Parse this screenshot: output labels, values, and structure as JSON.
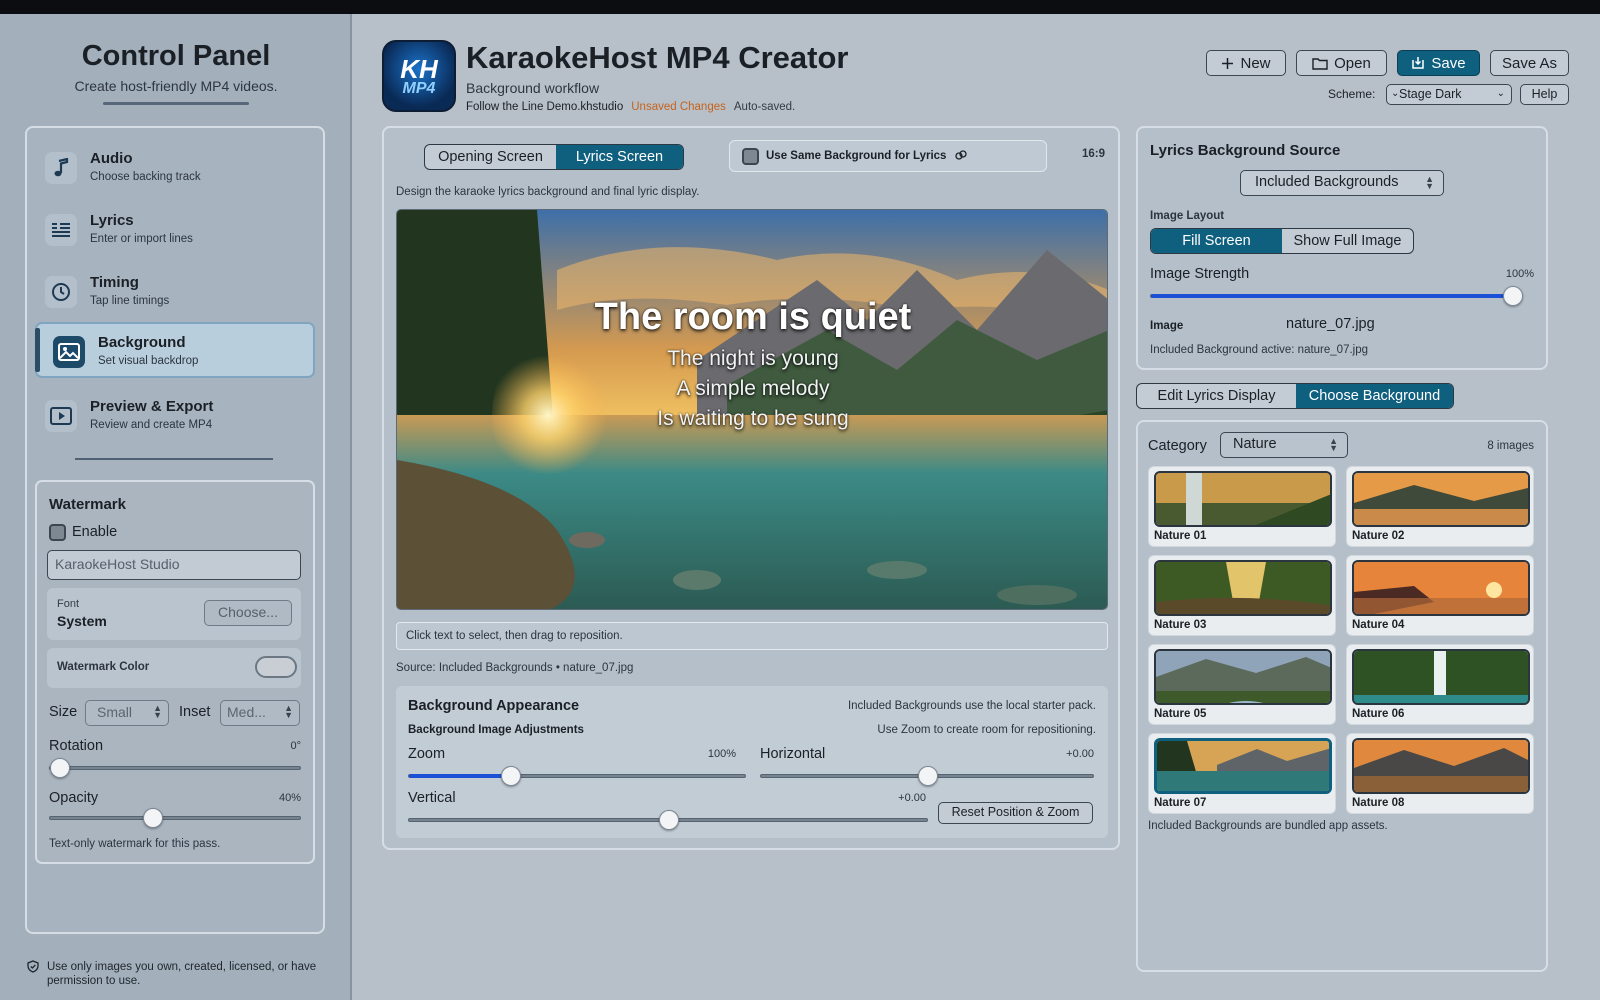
{
  "sidebar": {
    "title": "Control Panel",
    "subtitle": "Create host-friendly MP4 videos.",
    "steps": [
      {
        "title": "Audio",
        "subtitle": "Choose backing track",
        "icon": "music-note-icon"
      },
      {
        "title": "Lyrics",
        "subtitle": "Enter or import lines",
        "icon": "lyrics-list-icon"
      },
      {
        "title": "Timing",
        "subtitle": "Tap line timings",
        "icon": "timer-icon"
      },
      {
        "title": "Background",
        "subtitle": "Set visual backdrop",
        "icon": "image-icon",
        "active": true
      },
      {
        "title": "Preview & Export",
        "subtitle": "Review and create MP4",
        "icon": "play-screen-icon"
      }
    ],
    "watermark": {
      "title": "Watermark",
      "enable_label": "Enable",
      "enabled": false,
      "text_value": "KaraokeHost Studio",
      "font_label": "Font",
      "font_value": "System",
      "choose_label": "Choose...",
      "color_label": "Watermark Color",
      "size_label": "Size",
      "size_value": "Small",
      "inset_label": "Inset",
      "inset_value": "Med...",
      "rotation_label": "Rotation",
      "rotation_value": "0°",
      "rotation_fraction": 0.0,
      "opacity_label": "Opacity",
      "opacity_value": "40%",
      "opacity_fraction": 0.4,
      "note": "Text-only watermark for this pass."
    },
    "disclaimer": "Use only images you own, created, licensed, or have permission to use."
  },
  "header": {
    "logo_text_top": "KH",
    "logo_text_bottom": "MP4",
    "title": "KaraokeHost MP4 Creator",
    "subtitle": "Background workflow",
    "file_name": "Follow the Line Demo.khstudio",
    "unsaved": "Unsaved Changes",
    "autosave": "Auto-saved.",
    "buttons": {
      "new": "New",
      "open": "Open",
      "save": "Save",
      "save_as": "Save As"
    },
    "scheme_label": "Scheme:",
    "scheme_value": "Stage Dark",
    "help": "Help"
  },
  "center": {
    "tabs": [
      "Opening Screen",
      "Lyrics Screen"
    ],
    "active_tab": "Lyrics Screen",
    "same_bg_label": "Use Same Background for Lyrics",
    "aspect": "16:9",
    "description": "Design the karaoke lyrics background and final lyric display.",
    "lyrics": {
      "current": "The room is quiet",
      "next": [
        "The night is young",
        "A simple melody",
        "Is waiting to be sung"
      ]
    },
    "hint": "Click text to select, then drag to reposition.",
    "source": "Source: Included Backgrounds • nature_07.jpg",
    "appearance": {
      "title": "Background Appearance",
      "note1": "Included Backgrounds use the local starter pack.",
      "subtitle": "Background Image Adjustments",
      "note2": "Use Zoom to create room for repositioning.",
      "zoom_label": "Zoom",
      "zoom_value": "100%",
      "zoom_fraction": 0.29,
      "horizontal_label": "Horizontal",
      "horizontal_value": "+0.00",
      "horizontal_fraction": 0.5,
      "vertical_label": "Vertical",
      "vertical_value": "+0.00",
      "vertical_fraction": 0.5,
      "reset_label": "Reset Position & Zoom"
    }
  },
  "right": {
    "source_title": "Lyrics Background Source",
    "source_value": "Included Backgrounds",
    "layout_label": "Image Layout",
    "layout_options": [
      "Fill Screen",
      "Show Full Image"
    ],
    "layout_active": "Fill Screen",
    "strength_label": "Image Strength",
    "strength_value": "100%",
    "strength_fraction": 1.0,
    "image_label": "Image",
    "image_value": "nature_07.jpg",
    "image_active": "Included Background active: nature_07.jpg",
    "tabs": [
      "Edit Lyrics Display",
      "Choose Background"
    ],
    "active_tab": "Choose Background",
    "category_label": "Category",
    "category_value": "Nature",
    "image_count": "8 images",
    "thumbnails": [
      "Nature 01",
      "Nature 02",
      "Nature 03",
      "Nature 04",
      "Nature 05",
      "Nature 06",
      "Nature 07",
      "Nature 08"
    ],
    "selected_thumbnail": "Nature 07",
    "note": "Included Backgrounds are bundled app assets."
  },
  "colors": {
    "accent": "#0f5f7f",
    "unsaved": "#c5621c",
    "slider_fill": "#1a4fd6"
  }
}
